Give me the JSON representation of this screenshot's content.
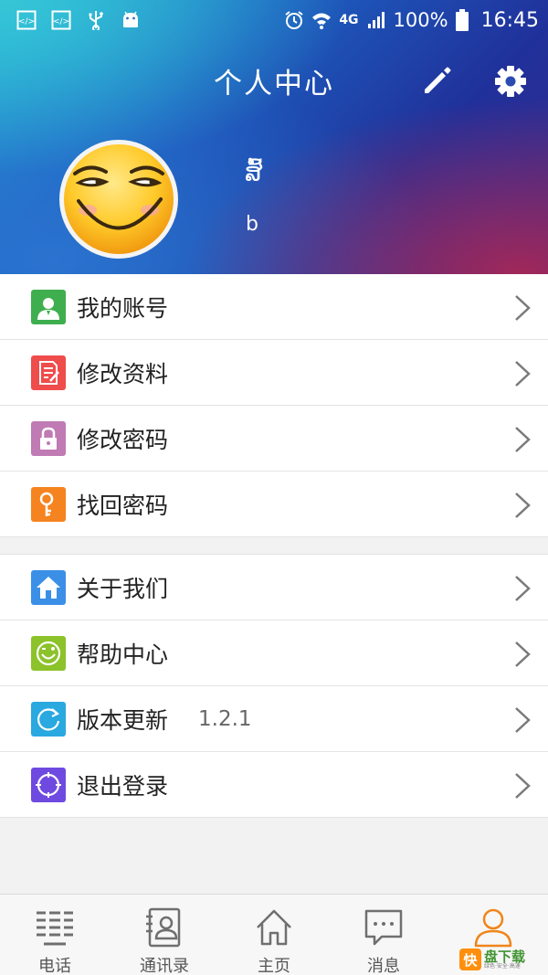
{
  "status_bar": {
    "battery": "100%",
    "network": "4G",
    "time": "16:45"
  },
  "header": {
    "title": "个人中心",
    "user_name": "ສົ້",
    "user_sub": "b"
  },
  "menu_group_1": [
    {
      "label": "我的账号",
      "icon": "user-icon",
      "color": "#3fae4f"
    },
    {
      "label": "修改资料",
      "icon": "edit-doc-icon",
      "color": "#ef4c4c"
    },
    {
      "label": "修改密码",
      "icon": "lock-icon",
      "color": "#c07ab4"
    },
    {
      "label": "找回密码",
      "icon": "key-icon",
      "color": "#f5831f"
    }
  ],
  "menu_group_2": [
    {
      "label": "关于我们",
      "icon": "home-icon",
      "color": "#3b8fe6"
    },
    {
      "label": "帮助中心",
      "icon": "smile-icon",
      "color": "#8cc22a"
    },
    {
      "label": "版本更新",
      "icon": "refresh-icon",
      "color": "#2aa8e0",
      "extra": "1.2.1"
    },
    {
      "label": "退出登录",
      "icon": "logout-icon",
      "color": "#6f4ae0"
    }
  ],
  "tabs": [
    {
      "label": "电话",
      "icon": "dialpad-icon"
    },
    {
      "label": "通讯录",
      "icon": "contacts-icon"
    },
    {
      "label": "主页",
      "icon": "home-outline-icon"
    },
    {
      "label": "消息",
      "icon": "message-icon"
    },
    {
      "label": "",
      "icon": "person-icon",
      "active": true
    }
  ],
  "watermark": {
    "badge": "快",
    "main": "盘下载",
    "sub": "绿色·安全·高速"
  }
}
